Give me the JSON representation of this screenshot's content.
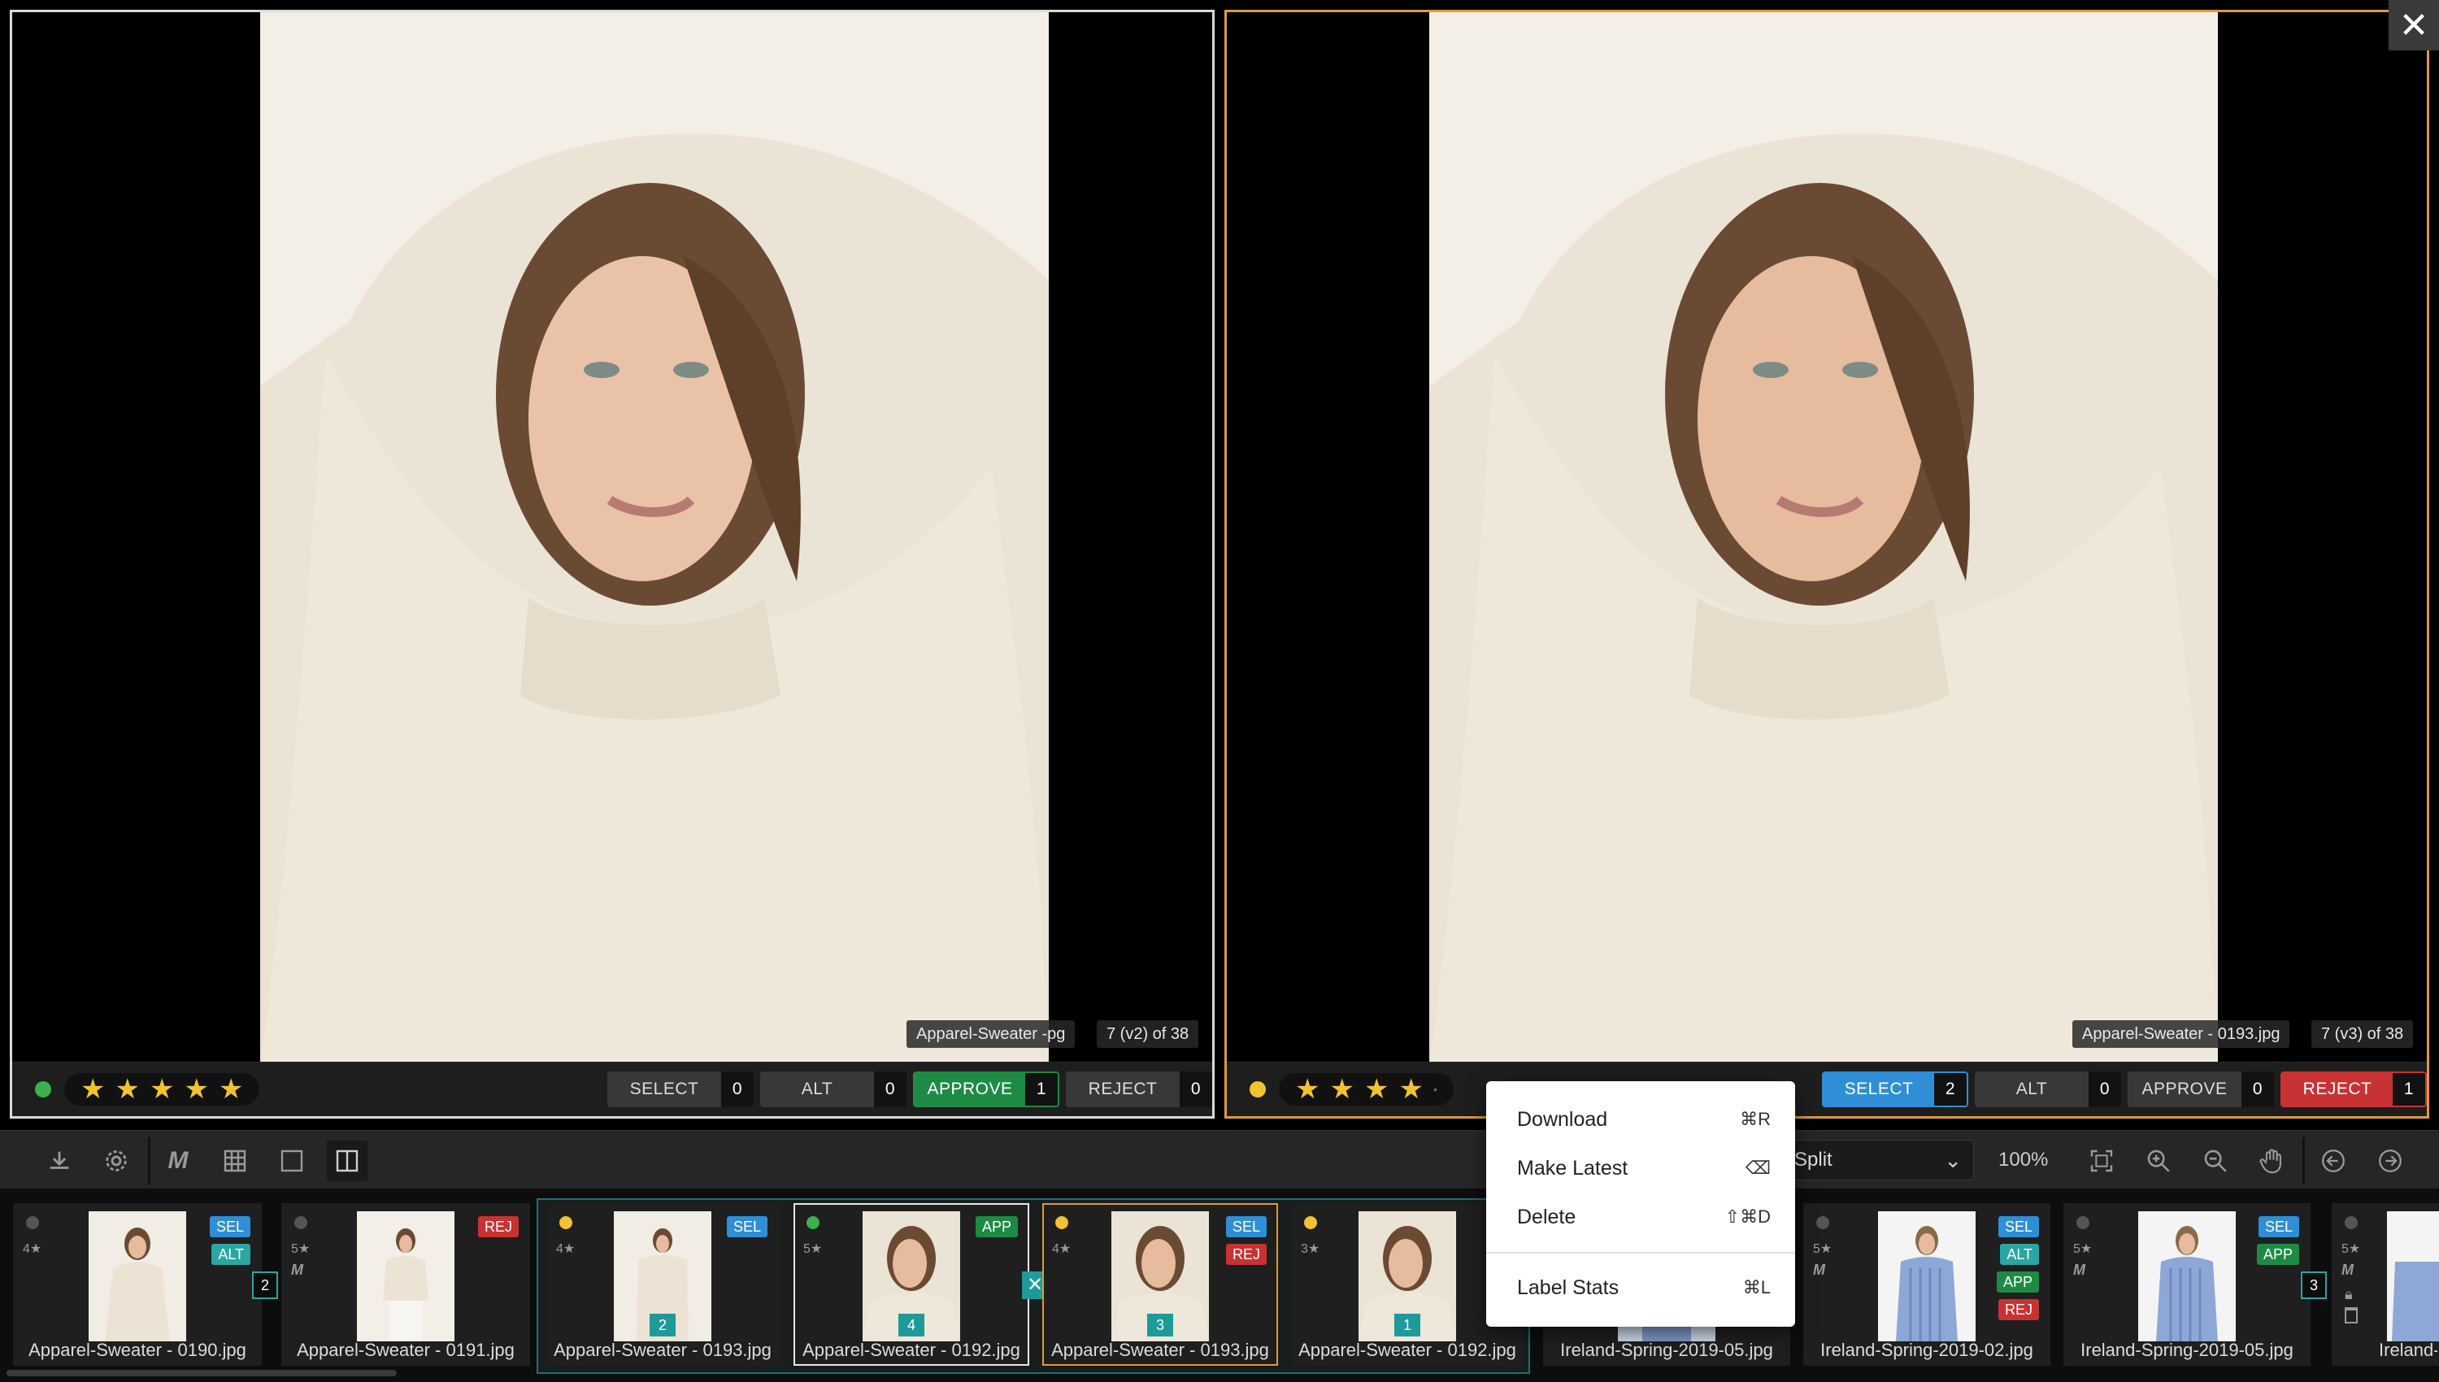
{
  "left_pane": {
    "filename": "Apparel-Sweater -pg",
    "counter": "7 (v2) of 38",
    "label_dot_color": "#3cb04a",
    "stars": [
      "★",
      "★",
      "★",
      "★",
      "★"
    ],
    "buttons": [
      {
        "label": "SELECT",
        "count": "0"
      },
      {
        "label": "ALT",
        "count": "0"
      },
      {
        "label": "APPROVE",
        "count": "1"
      },
      {
        "label": "REJECT",
        "count": "0"
      }
    ]
  },
  "right_pane": {
    "filename": "Apparel-Sweater - 0193.jpg",
    "counter": "7 (v3) of 38",
    "label_dot_color": "#f2c233",
    "stars": [
      "★",
      "★",
      "★",
      "★",
      "•"
    ],
    "buttons": [
      {
        "label": "SELECT",
        "count": "2"
      },
      {
        "label": "ALT",
        "count": "0"
      },
      {
        "label": "APPROVE",
        "count": "0"
      },
      {
        "label": "REJECT",
        "count": "1"
      }
    ]
  },
  "close_icon": "✕",
  "toolbar": {
    "view_mode": "Split",
    "zoom": "100%",
    "icons": [
      "download-icon",
      "gear-icon",
      "signature-icon",
      "grid-icon",
      "single-view-icon",
      "split-view-icon",
      "fit-icon",
      "zoom-in-icon",
      "zoom-out-icon",
      "hand-icon",
      "prev-icon",
      "next-icon"
    ]
  },
  "context_menu": {
    "items": [
      {
        "label": "Download",
        "shortcut": "⌘R"
      },
      {
        "label": "Make Latest",
        "shortcut": "⌫"
      },
      {
        "label": "Delete",
        "shortcut": "⇧⌘D"
      },
      {
        "label": "Label Stats",
        "shortcut": "⌘L"
      }
    ]
  },
  "filmstrip": {
    "thumbs": [
      {
        "name": "Apparel-Sweater - 0190.jpg",
        "rating": "4★",
        "tags": [
          "SEL",
          "ALT"
        ]
      },
      {
        "name": "Apparel-Sweater - 0191.jpg",
        "rating": "5★",
        "tags": [
          "REJ"
        ]
      },
      {
        "name": "Apparel-Sweater - 0193.jpg",
        "rating": "4★",
        "tags": [
          "SEL"
        ],
        "version": "2"
      },
      {
        "name": "Apparel-Sweater - 0192.jpg",
        "rating": "5★",
        "tags": [
          "APP"
        ],
        "version": "4"
      },
      {
        "name": "Apparel-Sweater - 0193.jpg",
        "rating": "4★",
        "tags": [
          "SEL",
          "REJ"
        ],
        "version": "3"
      },
      {
        "name": "Apparel-Sweater - 0192.jpg",
        "rating": "3★",
        "tags": [
          "S"
        ],
        "version": "1"
      },
      {
        "name": "Ireland-Spring-2019-05.jpg",
        "rating": "",
        "tags": []
      },
      {
        "name": "Ireland-Spring-2019-02.jpg",
        "rating": "5★",
        "tags": [
          "SEL",
          "ALT",
          "APP",
          "REJ"
        ]
      },
      {
        "name": "Ireland-Spring-2019-05.jpg",
        "rating": "5★",
        "tags": [
          "SEL",
          "APP"
        ]
      },
      {
        "name": "Ireland-Sprin",
        "rating": "5★",
        "tags": []
      }
    ],
    "stack_counts": [
      "2",
      "3"
    ],
    "mark": "M"
  }
}
